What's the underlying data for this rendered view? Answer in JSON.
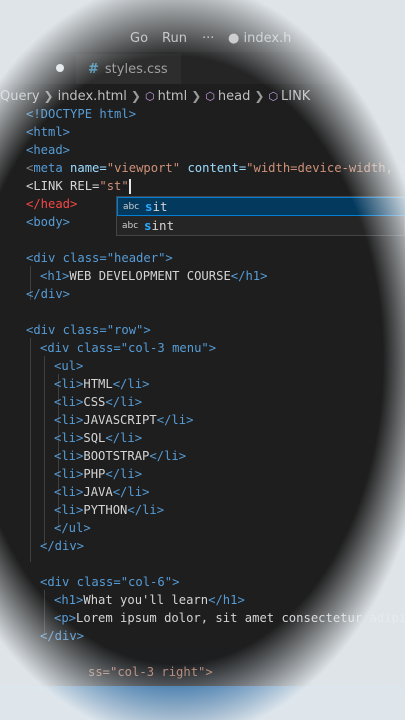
{
  "menubar": {
    "go": "Go",
    "run": "Run",
    "more": "···",
    "title": "● index.h"
  },
  "tabs": [
    {
      "label": "styles.css",
      "icon": "hash-icon"
    }
  ],
  "breadcrumb": [
    {
      "label": "Query"
    },
    {
      "label": "index.html"
    },
    {
      "label": "html"
    },
    {
      "label": "head"
    },
    {
      "label": "LINK"
    }
  ],
  "code": {
    "doctype": "<!DOCTYPE html>",
    "html_open": "<html>",
    "head_open": "<head>",
    "meta_name_attr": "name=",
    "meta_name_val": "\"viewport\"",
    "meta_content_attr": "content=",
    "meta_content_val": "\"width=device-width, i",
    "link_typed": "<LINK REL=",
    "link_value": "\"st\"",
    "head_close": "</head>",
    "body_open": "<body>",
    "div_header": "<div class=\"header\">",
    "h1_text": "WEB DEVELOPMENT COURSE",
    "div_close": "</div>",
    "div_row": "<div class=\"row\">",
    "div_col3": "<div class=\"col-3 menu\">",
    "ul_open": "<ul>",
    "ul_close": "</ul>",
    "menu_items": [
      "HTML",
      "CSS",
      "JAVASCRIPT",
      "SQL",
      "BOOTSTRAP",
      "PHP",
      "JAVA",
      "PYTHON"
    ],
    "div_col6": "<div class=\"col-6\">",
    "h1_learn": "What you'll learn",
    "p_text": "Lorem ipsum dolor, sit amet consectetur adipi",
    "div_col3_right": "ss=\"col-3 right\">"
  },
  "suggestions": [
    {
      "kind": "abc",
      "match": "s",
      "rest": "it",
      "selected": true
    },
    {
      "kind": "abc",
      "match": "s",
      "rest": "int",
      "selected": false
    }
  ],
  "colors": {
    "tag": "#569cd6",
    "attr": "#9cdcfe",
    "string": "#ce9178",
    "status": "#1f6fb8"
  }
}
